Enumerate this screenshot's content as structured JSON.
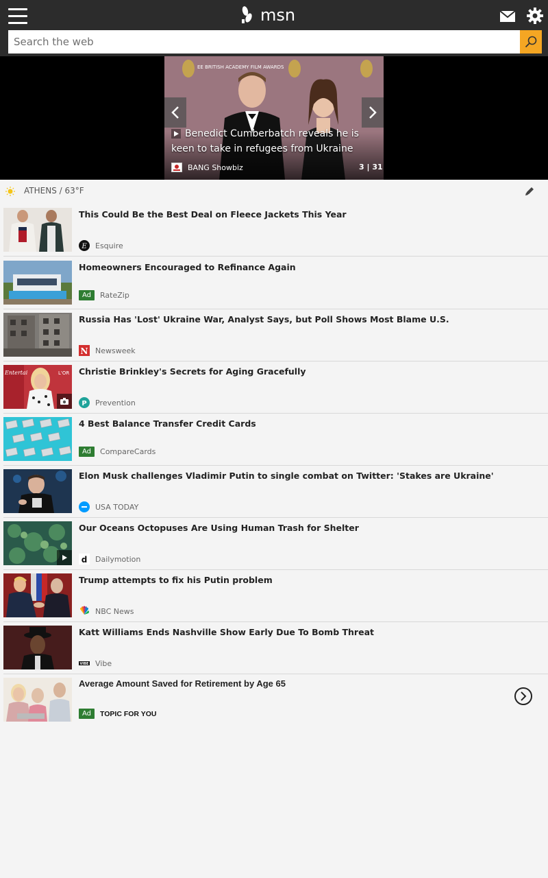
{
  "header": {
    "logo_text": "msn",
    "search_placeholder": "Search the web"
  },
  "hero": {
    "caption": "Benedict Cumberbatch reveals he is keen to take in refugees from Ukraine",
    "source": "BANG Showbiz",
    "counter": "3 | 31",
    "backdrop_text": "EE BRITISH ACADEMY FILM AWARDS"
  },
  "weather": {
    "location": "ATHENS / 63°F"
  },
  "news": [
    {
      "title": "This Could Be the Best Deal on Fleece Jackets This Year",
      "source": "Esquire",
      "ad": false,
      "badge": ""
    },
    {
      "title": "Homeowners Encouraged to Refinance Again",
      "source": "RateZip",
      "ad": true,
      "badge": ""
    },
    {
      "title": "Russia Has 'Lost' Ukraine War, Analyst Says, but Poll Shows Most Blame U.S.",
      "source": "Newsweek",
      "ad": false,
      "badge": ""
    },
    {
      "title": "Christie Brinkley's Secrets for Aging Gracefully",
      "source": "Prevention",
      "ad": false,
      "badge": "camera"
    },
    {
      "title": "4 Best Balance Transfer Credit Cards",
      "source": "CompareCards",
      "ad": true,
      "badge": ""
    },
    {
      "title": "Elon Musk challenges Vladimir Putin to single combat on Twitter: 'Stakes are Ukraine'",
      "source": "USA TODAY",
      "ad": false,
      "badge": ""
    },
    {
      "title": "Our Oceans Octopuses Are Using Human Trash for Shelter",
      "source": "Dailymotion",
      "ad": false,
      "badge": "play"
    },
    {
      "title": "Trump attempts to fix his Putin problem",
      "source": "NBC News",
      "ad": false,
      "badge": ""
    },
    {
      "title": "Katt Williams Ends Nashville Show Early Due To Bomb Threat",
      "source": "Vibe",
      "ad": false,
      "badge": ""
    },
    {
      "title": "Average Amount Saved for Retirement by Age 65",
      "source": "TOPIC FOR YOU",
      "ad": true,
      "badge": ""
    }
  ],
  "labels": {
    "ad": "Ad"
  },
  "source_logo_letters": {
    "esquire": "E",
    "newsweek": "N",
    "prevention": "P",
    "dailymotion": "d",
    "vibe": "VIBE"
  },
  "colors": {
    "topbar": "#2c2c2c",
    "search_button": "#f5a623",
    "ad_badge": "#2e7d32"
  }
}
